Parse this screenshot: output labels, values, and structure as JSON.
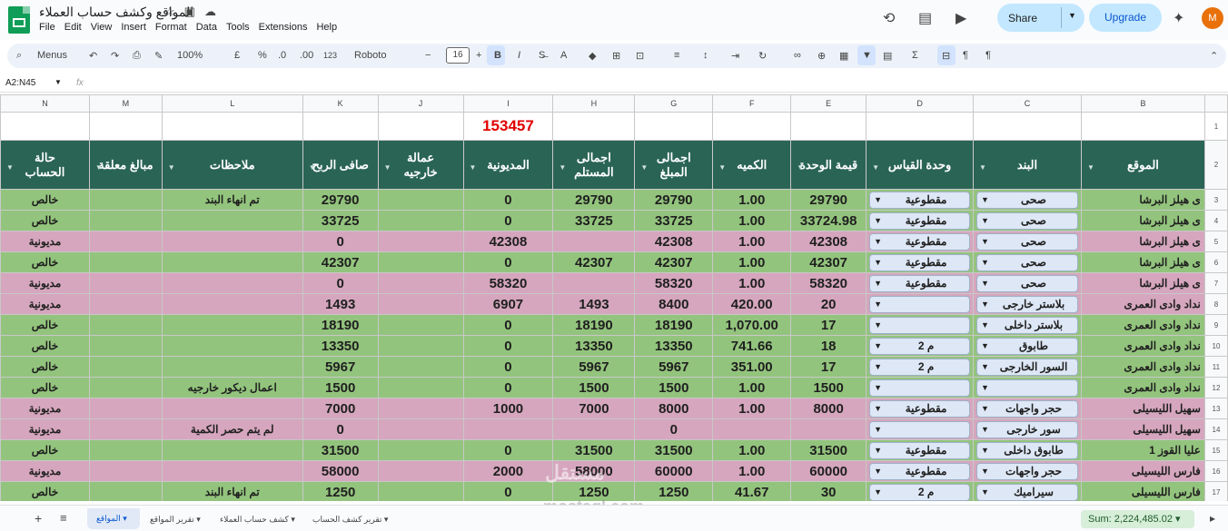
{
  "app": {
    "title": "المواقع وكشف حساب العملاء",
    "menus": [
      "File",
      "Edit",
      "View",
      "Insert",
      "Format",
      "Data",
      "Tools",
      "Extensions",
      "Help"
    ],
    "share": "Share",
    "upgrade": "Upgrade",
    "avatar": "M"
  },
  "toolbar": {
    "menus": "Menus",
    "zoom": "100%",
    "currency": "£",
    "percent": "%",
    "dec_dec": ".0",
    "inc_dec": ".00",
    "num": "123",
    "font": "Roboto",
    "size": "16"
  },
  "formula": {
    "name_box": "A2:N45",
    "fx": "fx"
  },
  "columns": [
    "N",
    "M",
    "L",
    "K",
    "J",
    "I",
    "H",
    "G",
    "F",
    "E",
    "D",
    "C",
    "B"
  ],
  "total": "153457",
  "headers": {
    "n": "حالة الحساب",
    "m": "مبالغ معلقة",
    "l": "ملاحظات",
    "k": "صافى الربح",
    "j": "عمالة خارجيه",
    "i": "المديونية",
    "h": "اجمالى المستلم",
    "g": "اجمالى المبلغ",
    "f": "الكميه",
    "e": "قيمة الوحدة",
    "d": "وحدة القياس",
    "c": "البند",
    "b": "الموقع"
  },
  "rows": [
    {
      "n": "3",
      "c": "g",
      "status": "خالص",
      "pending": "",
      "note": "تم انهاء البند",
      "net": "29790",
      "labor": "",
      "debt": "0",
      "rec": "29790",
      "totalamt": "29790",
      "qty": "1.00",
      "unit": "29790",
      "measure": "مقطوعية",
      "item": "صحى",
      "site": "ى هيلز البرشا"
    },
    {
      "n": "4",
      "c": "g",
      "status": "خالص",
      "pending": "",
      "note": "",
      "net": "33725",
      "labor": "",
      "debt": "0",
      "rec": "33725",
      "totalamt": "33725",
      "qty": "1.00",
      "unit": "33724.98",
      "measure": "مقطوعية",
      "item": "صحى",
      "site": "ى هيلز البرشا"
    },
    {
      "n": "5",
      "c": "p",
      "status": "مديونية",
      "pending": "",
      "note": "",
      "net": "0",
      "labor": "",
      "debt": "42308",
      "rec": "",
      "totalamt": "42308",
      "qty": "1.00",
      "unit": "42308",
      "measure": "مقطوعية",
      "item": "صحى",
      "site": "ى هيلز البرشا"
    },
    {
      "n": "6",
      "c": "g",
      "status": "خالص",
      "pending": "",
      "note": "",
      "net": "42307",
      "labor": "",
      "debt": "0",
      "rec": "42307",
      "totalamt": "42307",
      "qty": "1.00",
      "unit": "42307",
      "measure": "مقطوعية",
      "item": "صحى",
      "site": "ى هيلز البرشا"
    },
    {
      "n": "7",
      "c": "p",
      "status": "مديونية",
      "pending": "",
      "note": "",
      "net": "0",
      "labor": "",
      "debt": "58320",
      "rec": "",
      "totalamt": "58320",
      "qty": "1.00",
      "unit": "58320",
      "measure": "مقطوعية",
      "item": "صحى",
      "site": "ى هيلز البرشا"
    },
    {
      "n": "8",
      "c": "p",
      "status": "مديونية",
      "pending": "",
      "note": "",
      "net": "1493",
      "labor": "",
      "debt": "6907",
      "rec": "1493",
      "totalamt": "8400",
      "qty": "420.00",
      "unit": "20",
      "measure": "",
      "item": "بلاستر خارجى",
      "site": "نداد وادى العمرى"
    },
    {
      "n": "9",
      "c": "g",
      "status": "خالص",
      "pending": "",
      "note": "",
      "net": "18190",
      "labor": "",
      "debt": "0",
      "rec": "18190",
      "totalamt": "18190",
      "qty": "1,070.00",
      "unit": "17",
      "measure": "",
      "item": "بلاستر داخلى",
      "site": "نداد وادى العمرى"
    },
    {
      "n": "10",
      "c": "g",
      "status": "خالص",
      "pending": "",
      "note": "",
      "net": "13350",
      "labor": "",
      "debt": "0",
      "rec": "13350",
      "totalamt": "13350",
      "qty": "741.66",
      "unit": "18",
      "measure": "م 2",
      "item": "طابوق",
      "site": "نداد وادى العمرى"
    },
    {
      "n": "11",
      "c": "g",
      "status": "خالص",
      "pending": "",
      "note": "",
      "net": "5967",
      "labor": "",
      "debt": "0",
      "rec": "5967",
      "totalamt": "5967",
      "qty": "351.00",
      "unit": "17",
      "measure": "م 2",
      "item": "السور الخارجى",
      "site": "نداد وادى العمرى"
    },
    {
      "n": "12",
      "c": "g",
      "status": "خالص",
      "pending": "",
      "note": "اعمال ديكور خارجيه",
      "net": "1500",
      "labor": "",
      "debt": "0",
      "rec": "1500",
      "totalamt": "1500",
      "qty": "1.00",
      "unit": "1500",
      "measure": "",
      "item": "",
      "site": "نداد وادى العمرى"
    },
    {
      "n": "13",
      "c": "p",
      "status": "مديونية",
      "pending": "",
      "note": "",
      "net": "7000",
      "labor": "",
      "debt": "1000",
      "rec": "7000",
      "totalamt": "8000",
      "qty": "1.00",
      "unit": "8000",
      "measure": "مقطوعية",
      "item": "حجر واجهات",
      "site": "سهيل الليسيلى"
    },
    {
      "n": "14",
      "c": "p",
      "status": "مديونية",
      "pending": "",
      "note": "لم يتم حصر الكمية",
      "net": "0",
      "labor": "",
      "debt": "",
      "rec": "",
      "totalamt": "0",
      "qty": "",
      "unit": "",
      "measure": "",
      "item": "سور خارجى",
      "site": "سهيل الليسيلى"
    },
    {
      "n": "15",
      "c": "g",
      "status": "خالص",
      "pending": "",
      "note": "",
      "net": "31500",
      "labor": "",
      "debt": "0",
      "rec": "31500",
      "totalamt": "31500",
      "qty": "1.00",
      "unit": "31500",
      "measure": "مقطوعية",
      "item": "طابوق داخلى",
      "site": "عليا القوز 1"
    },
    {
      "n": "16",
      "c": "p",
      "status": "مديونية",
      "pending": "",
      "note": "",
      "net": "58000",
      "labor": "",
      "debt": "2000",
      "rec": "58000",
      "totalamt": "60000",
      "qty": "1.00",
      "unit": "60000",
      "measure": "مقطوعية",
      "item": "حجر واجهات",
      "site": "فارس الليسيلى"
    },
    {
      "n": "17",
      "c": "g",
      "status": "خالص",
      "pending": "",
      "note": "تم انهاء البند",
      "net": "1250",
      "labor": "",
      "debt": "0",
      "rec": "1250",
      "totalamt": "1250",
      "qty": "41.67",
      "unit": "30",
      "measure": "م 2",
      "item": "سيراميك",
      "site": "فارس الليسيلى"
    }
  ],
  "sheets": {
    "active": "المواقع",
    "tabs": [
      "تقرير المواقع",
      "كشف حساب العملاء",
      "تقرير كشف الحساب"
    ]
  },
  "sum": "Sum: 2,224,485.02",
  "watermark": {
    "ar": "مستقل",
    "en": "mostaql.com"
  }
}
